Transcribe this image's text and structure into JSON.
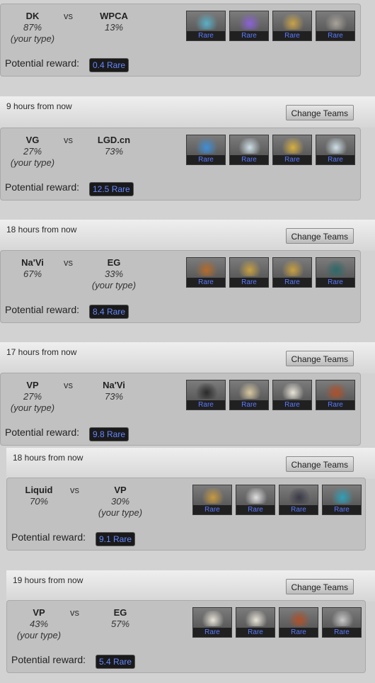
{
  "matches": [
    {
      "time": "",
      "change_label": "",
      "team1": {
        "name": "DK",
        "pct": "87%",
        "your_type": "(your type)"
      },
      "team2": {
        "name": "WPCA",
        "pct": "13%",
        "your_type": ""
      },
      "vs": "vs",
      "potential_label": "Potential reward:",
      "reward": "0.4 Rare",
      "items": [
        "Rare",
        "Rare",
        "Rare",
        "Rare"
      ]
    },
    {
      "time": "9 hours from now",
      "change_label": "Change Teams",
      "team1": {
        "name": "VG",
        "pct": "27%",
        "your_type": "(your type)"
      },
      "team2": {
        "name": "LGD.cn",
        "pct": "73%",
        "your_type": ""
      },
      "vs": "vs",
      "potential_label": "Potential reward:",
      "reward": "12.5 Rare",
      "items": [
        "Rare",
        "Rare",
        "Rare",
        "Rare"
      ]
    },
    {
      "time": "18 hours from now",
      "change_label": "Change Teams",
      "team1": {
        "name": "Na'Vi",
        "pct": "67%",
        "your_type": ""
      },
      "team2": {
        "name": "EG",
        "pct": "33%",
        "your_type": "(your type)"
      },
      "vs": "vs",
      "potential_label": "Potential reward:",
      "reward": "8.4 Rare",
      "items": [
        "Rare",
        "Rare",
        "Rare",
        "Rare"
      ]
    },
    {
      "time": "17 hours from now",
      "change_label": "Change Teams",
      "team1": {
        "name": "VP",
        "pct": "27%",
        "your_type": "(your type)"
      },
      "team2": {
        "name": "Na'Vi",
        "pct": "73%",
        "your_type": ""
      },
      "vs": "vs",
      "potential_label": "Potential reward:",
      "reward": "9.8 Rare",
      "items": [
        "Rare",
        "Rare",
        "Rare",
        "Rare"
      ]
    },
    {
      "time": "18 hours from now",
      "change_label": "Change Teams",
      "team1": {
        "name": "Liquid",
        "pct": "70%",
        "your_type": ""
      },
      "team2": {
        "name": "VP",
        "pct": "30%",
        "your_type": "(your type)"
      },
      "vs": "vs",
      "potential_label": "Potential reward:",
      "reward": "9.1 Rare",
      "items": [
        "Rare",
        "Rare",
        "Rare",
        "Rare"
      ]
    },
    {
      "time": "19 hours from now",
      "change_label": "Change Teams",
      "team1": {
        "name": "VP",
        "pct": "43%",
        "your_type": "(your type)"
      },
      "team2": {
        "name": "EG",
        "pct": "57%",
        "your_type": ""
      },
      "vs": "vs",
      "potential_label": "Potential reward:",
      "reward": "5.4 Rare",
      "items": [
        "Rare",
        "Rare",
        "Rare",
        "Rare"
      ]
    }
  ],
  "colors": {
    "reward_text": "#6688ff",
    "item_label": "#5b7bff",
    "card_bg": "#c1c1c1"
  }
}
